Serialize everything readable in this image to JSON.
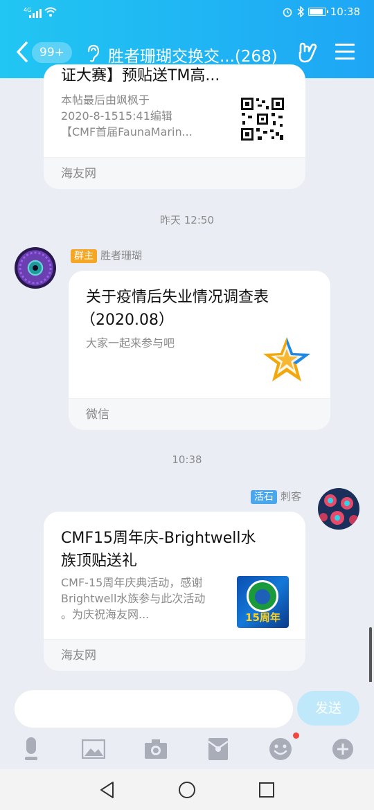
{
  "status": {
    "signal": "4G",
    "time": "10:38"
  },
  "header": {
    "back_count": "99+",
    "title": "胜者珊瑚交换交...(268)"
  },
  "messages": [
    {
      "card": {
        "title": "证大赛】预贴送TM高...",
        "desc_lines": [
          "本帖最后由飒枫于",
          "2020-8-1515:41编辑",
          "【CMF首届FaunaMarin..."
        ],
        "source": "海友网",
        "thumb_icon": "qr-code-icon"
      }
    },
    {
      "time": "昨天 12:50"
    },
    {
      "sender": {
        "role": "群主",
        "name": "胜者珊瑚"
      },
      "card": {
        "title_lines": [
          "关于疫情后失业情况调查表",
          "（2020.08）"
        ],
        "desc": "大家一起来参与吧",
        "source": "微信",
        "thumb_icon": "star-icon"
      }
    },
    {
      "time": "10:38"
    },
    {
      "sender": {
        "role": "活石",
        "name": "刺客"
      },
      "card": {
        "title_lines": [
          "CMF15周年庆-Brightwell水",
          "族顶贴送礼"
        ],
        "desc_lines": [
          "CMF-15周年庆典活动，感谢",
          "Brightwell水族参与此次活动",
          "。为庆祝海友网..."
        ],
        "source": "海友网",
        "thumb_text": "15周年"
      }
    }
  ],
  "composer": {
    "send_label": "发送",
    "placeholder": ""
  },
  "toolbar": [
    "mic-icon",
    "image-icon",
    "camera-icon",
    "red-packet-icon",
    "emoji-icon",
    "plus-icon"
  ],
  "colors": {
    "accent": "#1ea6f5",
    "owner_tag": "#f5a623",
    "member_tag": "#4aa7ee"
  }
}
